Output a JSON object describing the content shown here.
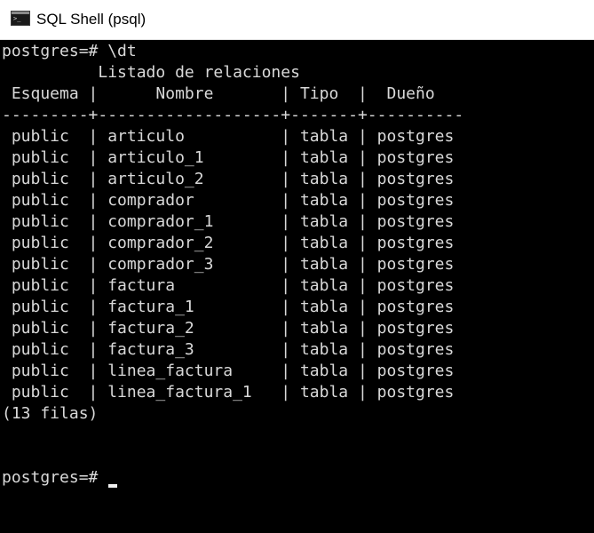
{
  "window": {
    "title": "SQL Shell (psql)",
    "icon": "terminal-app-icon",
    "icon_glyph": ">_"
  },
  "console": {
    "command_line": "postgres=# \\dt",
    "result_title": "          Listado de relaciones",
    "header": " Esquema |      Nombre       | Tipo  |  Dueño",
    "separator": "---------+-------------------+-------+----------",
    "rows": [
      " public  | articulo          | tabla | postgres",
      " public  | articulo_1        | tabla | postgres",
      " public  | articulo_2        | tabla | postgres",
      " public  | comprador         | tabla | postgres",
      " public  | comprador_1       | tabla | postgres",
      " public  | comprador_2       | tabla | postgres",
      " public  | comprador_3       | tabla | postgres",
      " public  | factura           | tabla | postgres",
      " public  | factura_1         | tabla | postgres",
      " public  | factura_2         | tabla | postgres",
      " public  | factura_3         | tabla | postgres",
      " public  | linea_factura     | tabla | postgres",
      " public  | linea_factura_1   | tabla | postgres"
    ],
    "row_count": "(13 filas)",
    "prompt": "postgres=# "
  },
  "colors": {
    "console_background": "#000000",
    "console_text": "#d9d9d9",
    "titlebar_background": "#ffffff"
  }
}
